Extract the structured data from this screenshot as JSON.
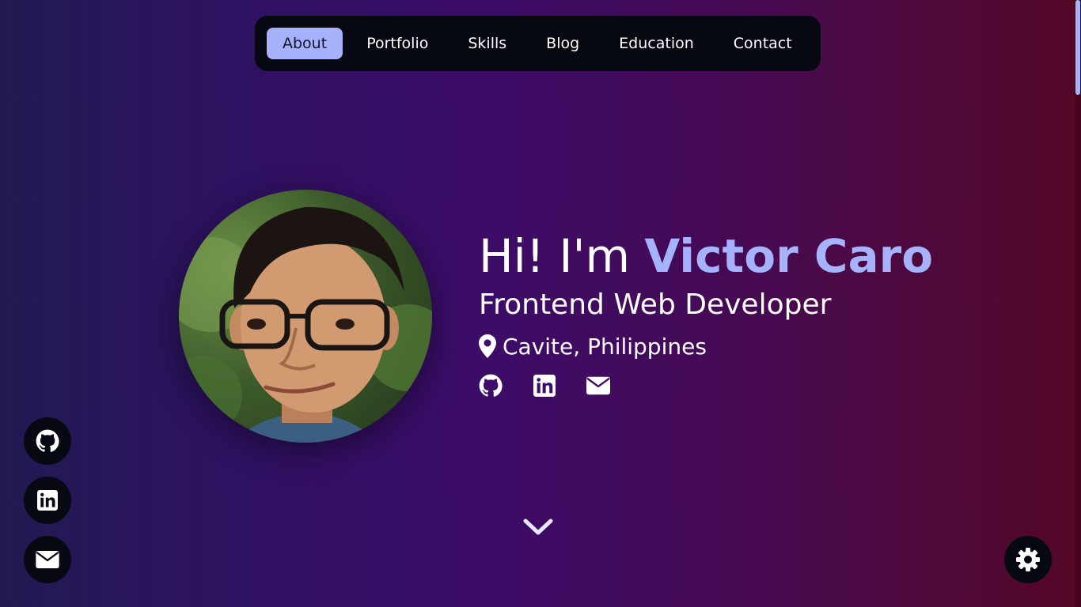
{
  "nav": {
    "items": [
      {
        "label": "About",
        "active": true
      },
      {
        "label": "Portfolio",
        "active": false
      },
      {
        "label": "Skills",
        "active": false
      },
      {
        "label": "Blog",
        "active": false
      },
      {
        "label": "Education",
        "active": false
      },
      {
        "label": "Contact",
        "active": false
      }
    ]
  },
  "hero": {
    "greeting_prefix": "Hi! I'm",
    "name": "Victor Caro",
    "role": "Frontend Web Developer",
    "location": "Cavite, Philippines",
    "avatar": "profile-photo"
  },
  "socials": {
    "inline": [
      "github-icon",
      "linkedin-icon",
      "email-icon"
    ],
    "floating": [
      "github-icon",
      "linkedin-icon",
      "email-icon"
    ]
  },
  "controls": {
    "scroll_down": "chevron-down-icon",
    "theme_toggle": "gear-icon"
  },
  "colors": {
    "accent": "#a6b2fb",
    "nav_bg": "#070912",
    "gradient_start": "#211a52",
    "gradient_mid": "#3c0c68",
    "gradient_end": "#540826",
    "text": "#ffffff"
  }
}
